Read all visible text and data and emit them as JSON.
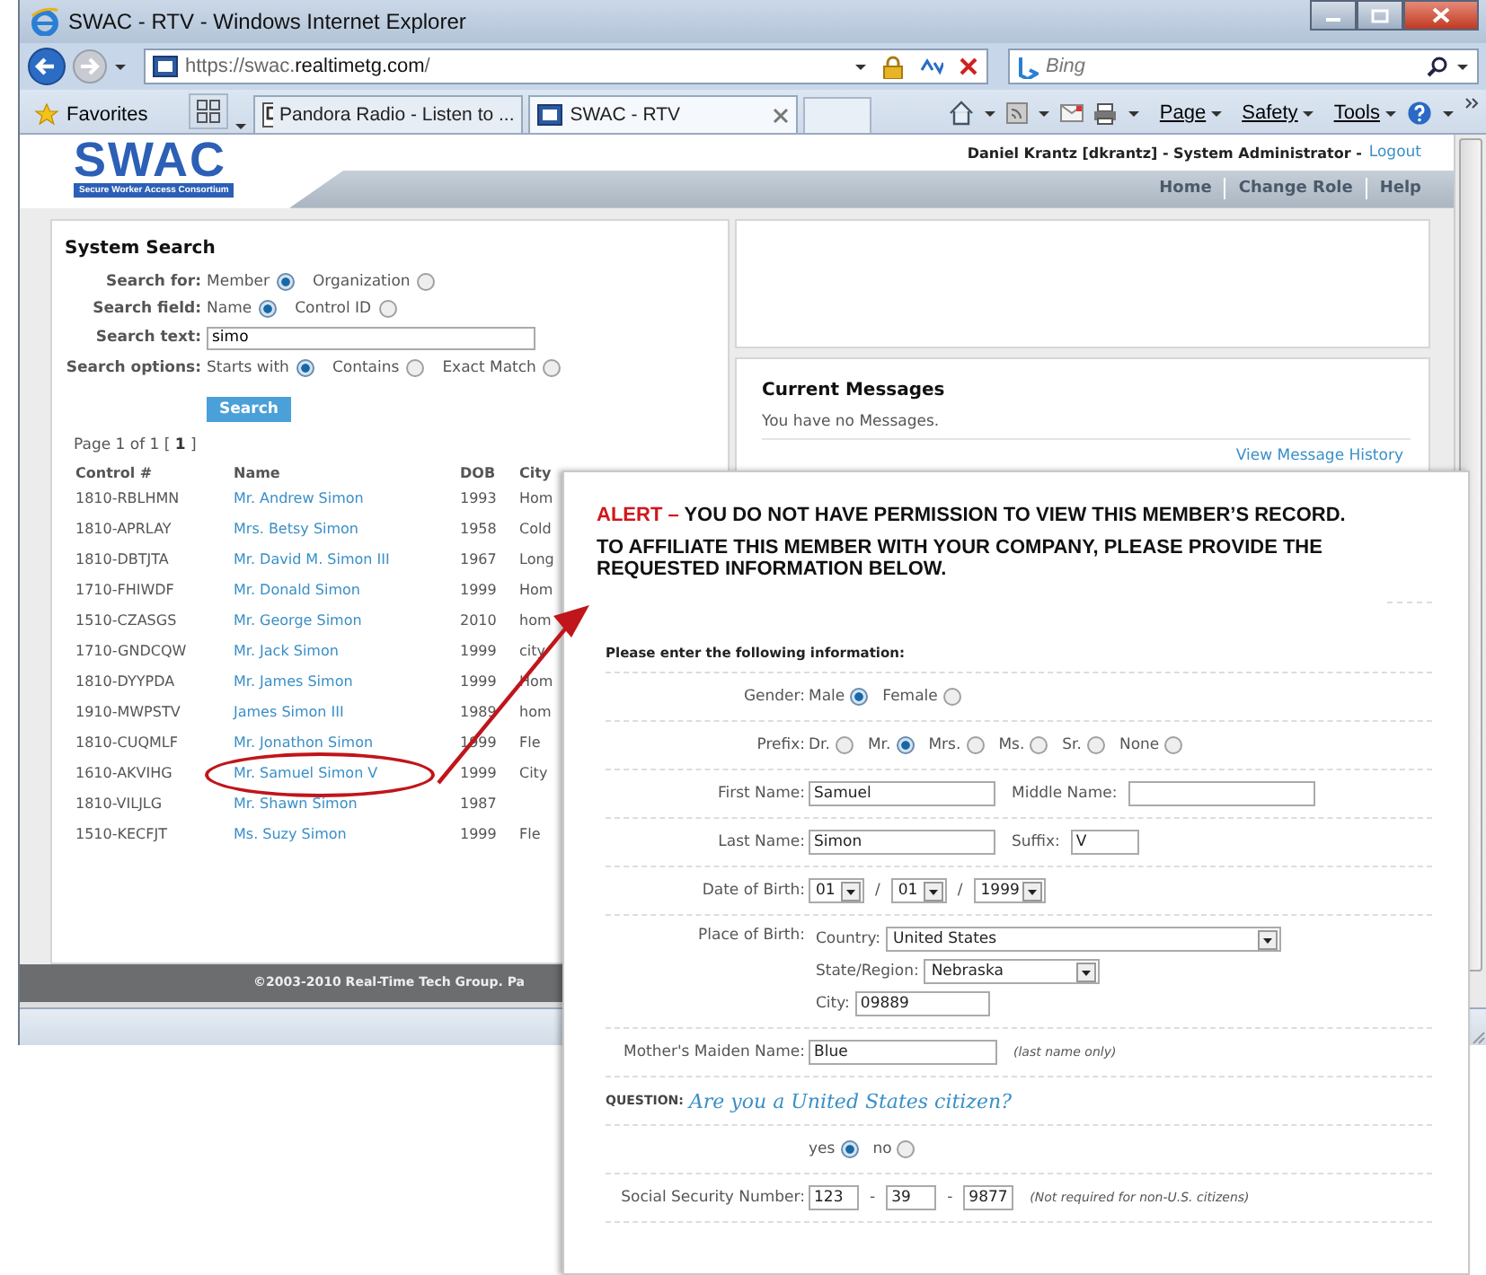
{
  "browser": {
    "title": "SWAC - RTV - Windows Internet Explorer",
    "url": "https://swac.**realtimetg.com**/",
    "search_placeholder": "Bing",
    "favorites": "Favorites",
    "tabs": [
      {
        "label": "Pandora Radio - Listen to ...",
        "selected": false
      },
      {
        "label": "SWAC - RTV",
        "selected": true
      }
    ],
    "commands": [
      "Page",
      "Safety",
      "Tools"
    ]
  },
  "site": {
    "logo": "SWAC",
    "tagline": "Secure Worker Access Consortium",
    "user": "Daniel Krantz [dkrantz] - System Administrator -",
    "logout": "Logout",
    "nav": [
      "Home",
      "Change Role",
      "Help"
    ]
  },
  "search": {
    "title": "System Search",
    "options": [
      {
        "label": "Search for:",
        "choices": [
          {
            "label": "Member",
            "selected": true
          },
          {
            "label": "Organization",
            "selected": false
          }
        ]
      },
      {
        "label": "Search field:",
        "choices": [
          {
            "label": "Name",
            "selected": true
          },
          {
            "label": "Control ID",
            "selected": false
          }
        ]
      }
    ],
    "text_label": "Search text:",
    "text_value": "simo",
    "match": {
      "label": "Search options:",
      "choices": [
        {
          "label": "Starts with",
          "selected": true
        },
        {
          "label": "Contains",
          "selected": false
        },
        {
          "label": "Exact Match",
          "selected": false
        }
      ]
    },
    "button": "Search",
    "paging": "Page 1 of 1 [ **1** ]",
    "columns": [
      "Control #",
      "Name",
      "DOB",
      "City"
    ],
    "rows": [
      {
        "control": "1810-RBLHMN",
        "name": "Mr. Andrew Simon",
        "dob": "1993",
        "city": "Hom",
        "circled": false
      },
      {
        "control": "1810-APRLAY",
        "name": "Mrs. Betsy Simon",
        "dob": "1958",
        "city": "Cold",
        "circled": false
      },
      {
        "control": "1810-DBTJTA",
        "name": "Mr. David M. Simon III",
        "dob": "1967",
        "city": "Long",
        "circled": false
      },
      {
        "control": "1710-FHIWDF",
        "name": "Mr. Donald Simon",
        "dob": "1999",
        "city": "Hom",
        "circled": false
      },
      {
        "control": "1510-CZASGS",
        "name": "Mr. George Simon",
        "dob": "2010",
        "city": "hom",
        "circled": false
      },
      {
        "control": "1710-GNDCQW",
        "name": "Mr. Jack Simon",
        "dob": "1999",
        "city": "city",
        "circled": false
      },
      {
        "control": "1810-DYYPDA",
        "name": "Mr. James Simon",
        "dob": "1999",
        "city": "Hom",
        "circled": false
      },
      {
        "control": "1910-MWPSTV",
        "name": "James Simon III",
        "dob": "1989",
        "city": "hom",
        "circled": false
      },
      {
        "control": "1810-CUQMLF",
        "name": "Mr. Jonathon Simon",
        "dob": "1999",
        "city": "Fle",
        "circled": false
      },
      {
        "control": "1610-AKVIHG",
        "name": "Mr. Samuel Simon V",
        "dob": "1999",
        "city": "City",
        "circled": true
      },
      {
        "control": "1810-VILJLG",
        "name": "Mr. Shawn Simon",
        "dob": "1987",
        "circled": false
      },
      {
        "control": "1510-KECFJT",
        "name": "Ms. Suzy Simon",
        "dob": "1999",
        "city": "Fle",
        "circled": false
      }
    ]
  },
  "messages": {
    "title": "Current Messages",
    "text": "You have no Messages.",
    "link": "View Message History"
  },
  "footer": "©2003-2010 Real-Time Tech Group. Pa",
  "popup": {
    "alert_label": "ALERT –",
    "alert_text": "YOU DO NOT HAVE PERMISSION TO VIEW THIS MEMBER’S RECORD.",
    "instruction": "TO AFFILIATE THIS MEMBER WITH YOUR COMPANY, PLEASE PROVIDE THE REQUESTED INFORMATION BELOW.",
    "form_title": "Please enter the following information:",
    "rows": [
      {
        "kind": "radio",
        "label": "Gender:",
        "options": [
          {
            "label": "Male",
            "selected": true
          },
          {
            "label": "Female",
            "selected": false
          }
        ]
      },
      {
        "kind": "radio",
        "label": "Prefix:",
        "options": [
          {
            "label": "Dr.",
            "selected": false
          },
          {
            "label": "Mr.",
            "selected": true
          },
          {
            "label": "Mrs.",
            "selected": false
          },
          {
            "label": "Ms.",
            "selected": false
          },
          {
            "label": "Sr.",
            "selected": false
          },
          {
            "label": "None",
            "selected": false
          }
        ]
      },
      {
        "kind": "name",
        "fields": [
          {
            "label": "First Name:",
            "value": "Samuel"
          },
          {
            "label": "Middle Name:"
          }
        ]
      },
      {
        "kind": "name-suffix",
        "fields": [
          {
            "label": "Last Name:",
            "value": "Simon"
          },
          {
            "label": "Suffix:",
            "value": "V"
          }
        ]
      },
      {
        "kind": "date",
        "label": "Date of Birth:",
        "values": [
          "01",
          "01",
          "1999"
        ],
        "separators": [
          "/",
          "/"
        ]
      },
      {
        "kind": "place",
        "label": "Place of Birth:",
        "lines": [
          {
            "label": "Country:",
            "value": "United States",
            "kind": "select"
          },
          {
            "label": "State/Region:",
            "value": "Nebraska",
            "kind": "select"
          },
          {
            "label": "City:",
            "value": "09889",
            "kind": "input"
          }
        ]
      },
      {
        "kind": "note",
        "label": "Mother's Maiden Name:",
        "value": "Blue",
        "note": "(last name only)"
      },
      {
        "kind": "question",
        "label": "QUESTION:",
        "text": "Are you a United States citizen?"
      },
      {
        "kind": "choice",
        "options": [
          {
            "label": "yes",
            "selected": true
          },
          {
            "label": "no",
            "selected": false
          }
        ]
      },
      {
        "kind": "ssn",
        "label": "Social Security Number:",
        "values": [
          "123",
          "39",
          "9877"
        ],
        "separators": [
          "-",
          "-"
        ],
        "note": "(Not required for non-U.S. citizens)"
      }
    ]
  }
}
